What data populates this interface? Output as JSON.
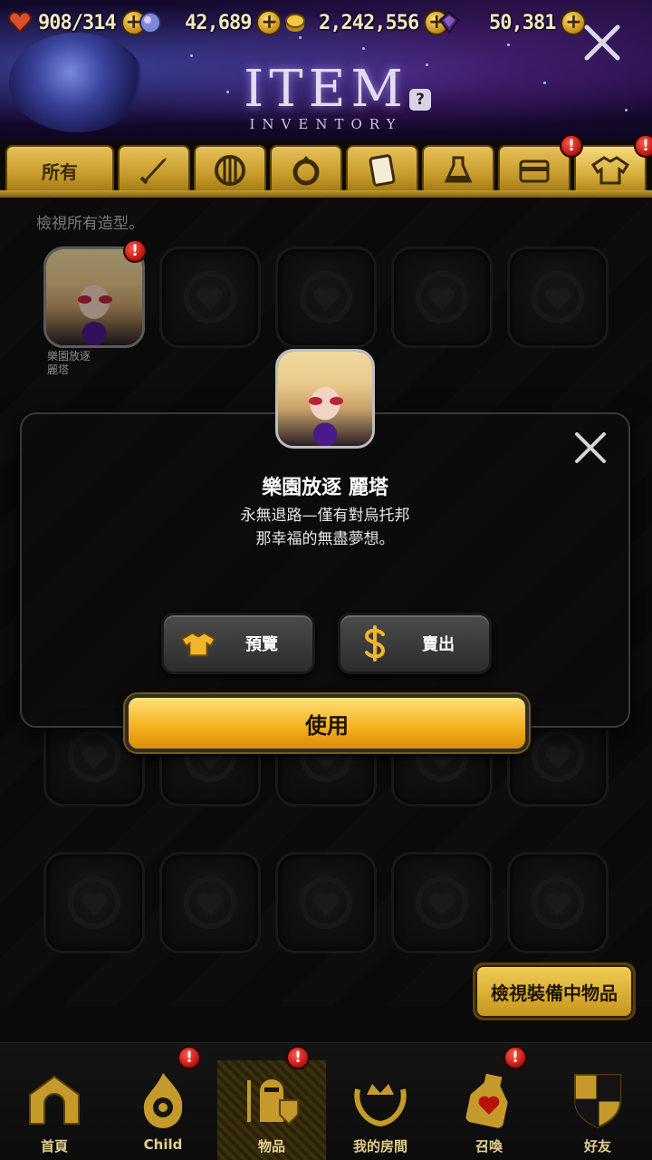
{
  "header": {
    "resources": [
      {
        "icon": "heart-icon",
        "value": "908/314"
      },
      {
        "icon": "gem-icon",
        "value": "42,689"
      },
      {
        "icon": "gold-coin-icon",
        "value": "2,242,556"
      },
      {
        "icon": "dark-crystal-icon",
        "value": "50,381"
      }
    ],
    "title": "ITEM",
    "subtitle": "INVENTORY",
    "help": "?"
  },
  "tabs": [
    {
      "label": "所有",
      "icon": "all-tab"
    },
    {
      "icon": "sword-icon"
    },
    {
      "icon": "shield-icon"
    },
    {
      "icon": "ring-icon"
    },
    {
      "icon": "card-icon"
    },
    {
      "icon": "potion-icon"
    },
    {
      "icon": "ticket-icon"
    },
    {
      "icon": "costume-icon"
    }
  ],
  "grid": {
    "hint": "檢視所有造型。",
    "item_name": "樂園放逐\n麗塔"
  },
  "modal": {
    "title": "樂園放逐 麗塔",
    "desc_line1": "永無退路—僅有對烏托邦",
    "desc_line2": "那幸福的無盡夢想。",
    "preview_label": "預覽",
    "sell_label": "賣出",
    "use_label": "使用"
  },
  "equipped_label": "檢視裝備中物品",
  "nav": [
    {
      "label": "首頁",
      "icon": "home-gate-icon"
    },
    {
      "label": "Child",
      "icon": "flame-eye-icon"
    },
    {
      "label": "物品",
      "icon": "knight-icon"
    },
    {
      "label": "我的房間",
      "icon": "crown-wreath-icon"
    },
    {
      "label": "召喚",
      "icon": "potion-heart-icon"
    },
    {
      "label": "好友",
      "icon": "shield-emblem-icon"
    }
  ],
  "colors": {
    "accent_gold": "#d7ad3c",
    "alert_red": "#d01a12"
  }
}
